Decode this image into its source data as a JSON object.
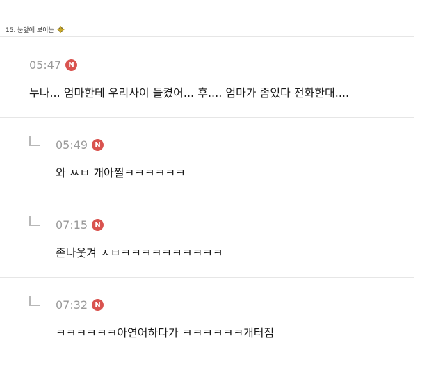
{
  "header": {
    "title": "15. 눈앞에 보이는",
    "emoji_icon": "sparkle-badge-icon"
  },
  "comments": [
    {
      "time": "05:47",
      "badge": "N",
      "text": "누나... 엄마한테 우리사이 들켰어... 후.... 엄마가 좀있다 전화한대....",
      "is_reply": false
    },
    {
      "time": "05:49",
      "badge": "N",
      "text": "와 ㅆㅂ 개아찔ㅋㅋㅋㅋㅋㅋ",
      "is_reply": true
    },
    {
      "time": "07:15",
      "badge": "N",
      "text": "존나웃겨 ㅅㅂㅋㅋㅋㅋㅋㅋㅋㅋㅋㅋ",
      "is_reply": true
    },
    {
      "time": "07:32",
      "badge": "N",
      "text": "ㅋㅋㅋㅋㅋㅋ아연어하다가 ㅋㅋㅋㅋㅋㅋ개터짐",
      "is_reply": true
    }
  ],
  "colors": {
    "badge": "#d9534f",
    "time": "#9a9a9a",
    "divider": "#e6e6e6"
  }
}
